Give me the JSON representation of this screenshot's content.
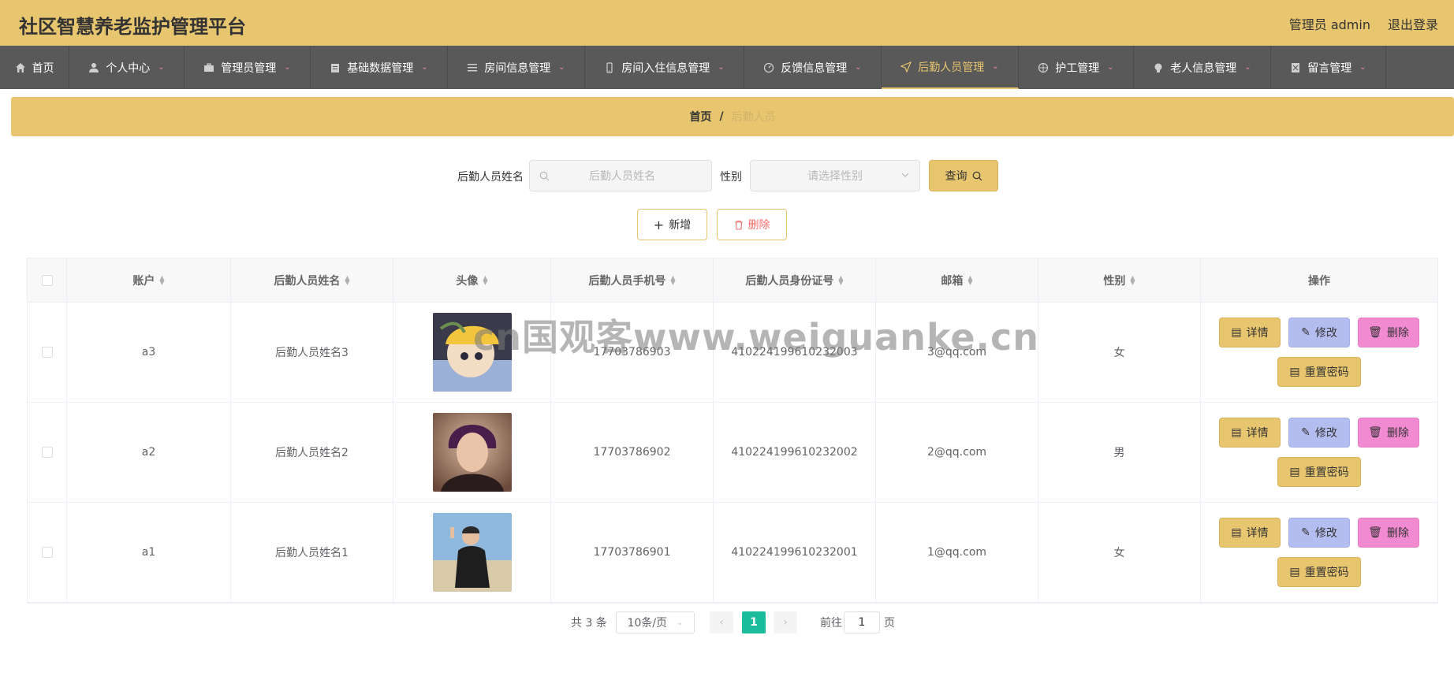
{
  "header": {
    "title": "社区智慧养老监护管理平台",
    "user_label": "管理员 admin",
    "logout_label": "退出登录"
  },
  "nav": {
    "items": [
      {
        "label": "首页",
        "icon": "home-icon",
        "has_dropdown": false,
        "active": false
      },
      {
        "label": "个人中心",
        "icon": "user-icon",
        "has_dropdown": true,
        "active": false
      },
      {
        "label": "管理员管理",
        "icon": "briefcase-icon",
        "has_dropdown": true,
        "active": false
      },
      {
        "label": "基础数据管理",
        "icon": "clipboard-icon",
        "has_dropdown": true,
        "active": false
      },
      {
        "label": "房间信息管理",
        "icon": "list-icon",
        "has_dropdown": true,
        "active": false
      },
      {
        "label": "房间入住信息管理",
        "icon": "mobile-icon",
        "has_dropdown": true,
        "active": false
      },
      {
        "label": "反馈信息管理",
        "icon": "gauge-icon",
        "has_dropdown": true,
        "active": false
      },
      {
        "label": "后勤人员管理",
        "icon": "navigation-icon",
        "has_dropdown": true,
        "active": true
      },
      {
        "label": "护工管理",
        "icon": "target-icon",
        "has_dropdown": true,
        "active": false
      },
      {
        "label": "老人信息管理",
        "icon": "bulb-icon",
        "has_dropdown": true,
        "active": false
      },
      {
        "label": "留言管理",
        "icon": "document-icon",
        "has_dropdown": true,
        "active": false
      }
    ]
  },
  "breadcrumb": {
    "home": "首页",
    "separator": "/",
    "current": "后勤人员"
  },
  "search": {
    "name_label": "后勤人员姓名",
    "name_placeholder": "后勤人员姓名",
    "gender_label": "性别",
    "gender_placeholder": "请选择性别",
    "query_label": "查询"
  },
  "actions": {
    "add_label": "新增",
    "delete_label": "删除"
  },
  "table": {
    "columns": [
      "账户",
      "后勤人员姓名",
      "头像",
      "后勤人员手机号",
      "后勤人员身份证号",
      "邮箱",
      "性别",
      "操作"
    ],
    "rows": [
      {
        "account": "a3",
        "name": "后勤人员姓名3",
        "phone": "17703786903",
        "id_number": "410224199610232003",
        "email": "3@qq.com",
        "gender": "女"
      },
      {
        "account": "a2",
        "name": "后勤人员姓名2",
        "phone": "17703786902",
        "id_number": "410224199610232002",
        "email": "2@qq.com",
        "gender": "男"
      },
      {
        "account": "a1",
        "name": "后勤人员姓名1",
        "phone": "17703786901",
        "id_number": "410224199610232001",
        "email": "1@qq.com",
        "gender": "女"
      }
    ],
    "op_labels": {
      "detail": "详情",
      "edit": "修改",
      "delete": "删除",
      "reset": "重置密码"
    }
  },
  "pagination": {
    "total_text": "共 3 条",
    "page_size": "10条/页",
    "current_page": "1",
    "goto_prefix": "前往",
    "goto_value": "1",
    "goto_suffix": "页"
  },
  "watermark": "cn国观客www.weiguanke.cn",
  "colors": {
    "header_bg": "#e8c56f",
    "nav_bg": "#595959",
    "active_nav": "#e8c56f",
    "edit_btn": "#b3bdf0",
    "delete_btn": "#f28ad2",
    "page_active": "#1abc9c"
  }
}
